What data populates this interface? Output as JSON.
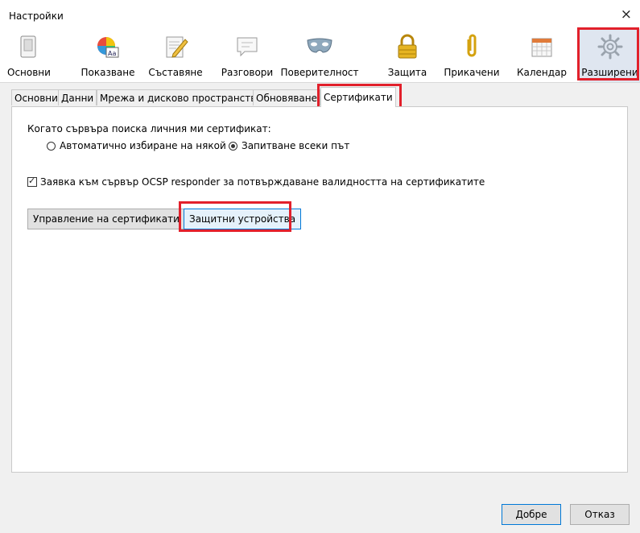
{
  "window": {
    "title": "Настройки",
    "close_glyph": "×"
  },
  "toolbar": {
    "panes": [
      {
        "label": "Основни",
        "icon": "general-icon"
      },
      {
        "label": "Показване",
        "icon": "display-icon"
      },
      {
        "label": "Съставяне",
        "icon": "composition-icon"
      },
      {
        "label": "Разговори",
        "icon": "chat-icon"
      },
      {
        "label": "Поверителност",
        "icon": "privacy-mask-icon"
      },
      {
        "label": "Защита",
        "icon": "security-lock-icon"
      },
      {
        "label": "Прикачени",
        "icon": "attachment-clip-icon"
      },
      {
        "label": "Календар",
        "icon": "calendar-icon"
      },
      {
        "label": "Разширени",
        "icon": "advanced-gear-icon",
        "selected": true
      }
    ]
  },
  "tabs": [
    {
      "label": "Основни"
    },
    {
      "label": "Данни"
    },
    {
      "label": "Мрежа и дисково пространство"
    },
    {
      "label": "Обновяване"
    },
    {
      "label": "Сертификати",
      "active": true
    }
  ],
  "certificates": {
    "request_label": "Когато сървъра поиска личния ми сертификат:",
    "radio_auto": "Автоматично избиране на някой",
    "radio_ask": "Запитване всеки път",
    "selected_radio": "ask",
    "ocsp_label": "Заявка към сървър OCSP responder за потвърждаване валидността на сертификатите",
    "ocsp_checked": true,
    "manage_button": "Управление на сертификати",
    "devices_button": "Защитни устройства"
  },
  "footer": {
    "ok": "Добре",
    "cancel": "Отказ"
  },
  "colors": {
    "highlight": "#e2202b",
    "focus": "#0078d7",
    "selected_pane": "#dfe6f0"
  }
}
